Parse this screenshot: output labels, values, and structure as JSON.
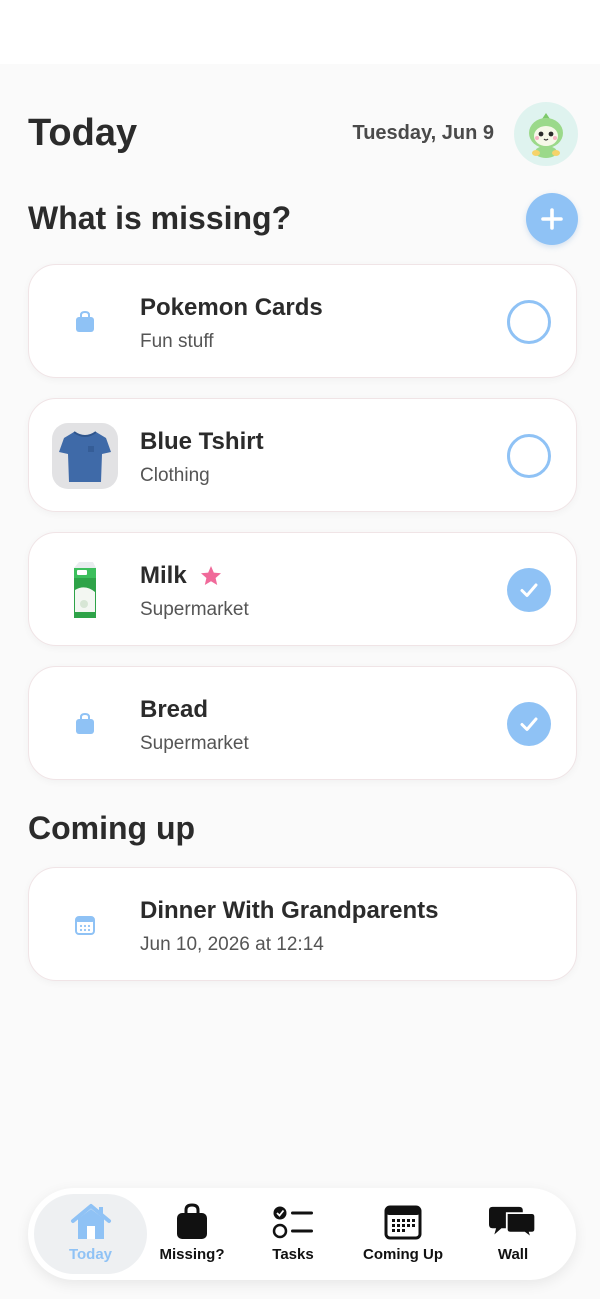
{
  "header": {
    "title": "Today",
    "date": "Tuesday, Jun 9"
  },
  "missing_section": {
    "title": "What is missing?",
    "items": [
      {
        "name": "Pokemon Cards",
        "category": "Fun stuff",
        "thumbnail": "bag-icon",
        "checked": false,
        "starred": false
      },
      {
        "name": "Blue Tshirt",
        "category": "Clothing",
        "thumbnail": "tshirt-image",
        "checked": false,
        "starred": false
      },
      {
        "name": "Milk",
        "category": "Supermarket",
        "thumbnail": "milk-carton-image",
        "checked": true,
        "starred": true
      },
      {
        "name": "Bread",
        "category": "Supermarket",
        "thumbnail": "bag-icon",
        "checked": true,
        "starred": false
      }
    ]
  },
  "coming_up_section": {
    "title": "Coming up",
    "events": [
      {
        "name": "Dinner With Grandparents",
        "datetime": "Jun 10, 2026 at 12:14",
        "icon": "calendar-icon"
      }
    ]
  },
  "tabbar": {
    "active": "Today",
    "tabs": [
      {
        "label": "Today",
        "icon": "house-icon"
      },
      {
        "label": "Missing?",
        "icon": "bag-icon"
      },
      {
        "label": "Tasks",
        "icon": "checklist-icon"
      },
      {
        "label": "Coming Up",
        "icon": "calendar-icon"
      },
      {
        "label": "Wall",
        "icon": "chat-bubbles-icon"
      }
    ]
  },
  "colors": {
    "accent": "#8fc2f5",
    "star": "#f06a9a",
    "text": "#2b2b2b",
    "background": "#fafafa"
  }
}
